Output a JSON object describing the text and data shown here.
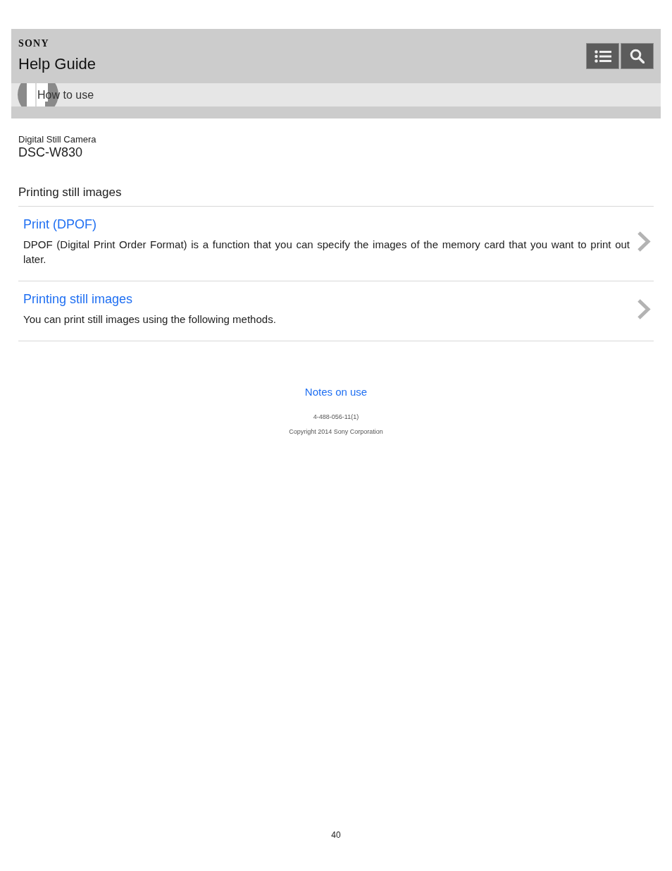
{
  "header": {
    "logo": "SONY",
    "title": "Help Guide",
    "buttons": [
      {
        "kind": "list"
      },
      {
        "kind": "search"
      }
    ]
  },
  "breadcrumb": {
    "label": "How to use"
  },
  "product": {
    "category": "Digital Still Camera",
    "model": "DSC-W830"
  },
  "section_title": "Printing still images",
  "topics": [
    {
      "title": "Print (DPOF)",
      "description": "DPOF (Digital Print Order Format) is a function that you can specify the images of the memory card that you want to print out later."
    },
    {
      "title": "Printing still images",
      "description": "You can print still images using the following methods."
    }
  ],
  "footer": {
    "link": "Notes on use",
    "code": "4-488-056-11(1)",
    "copyright": "Copyright 2014 Sony Corporation"
  },
  "page_number": "40"
}
